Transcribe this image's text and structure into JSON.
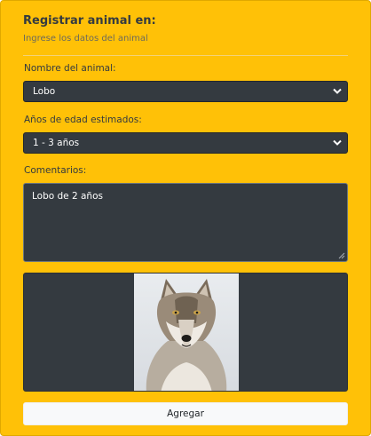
{
  "form": {
    "title": "Registrar animal en:",
    "subtitle": "Ingrese los datos del animal",
    "animal_label": "Nombre del animal:",
    "animal_value": "Lobo",
    "age_label": "Años de edad estimados:",
    "age_value": "1 - 3 años",
    "comments_label": "Comentarios:",
    "comments_value": "Lobo de 2 años",
    "image_subject": "wolf-photo",
    "submit_label": "Agregar"
  },
  "colors": {
    "card_bg": "#ffc107",
    "field_bg": "#343a40",
    "button_bg": "#f8f9fa"
  }
}
